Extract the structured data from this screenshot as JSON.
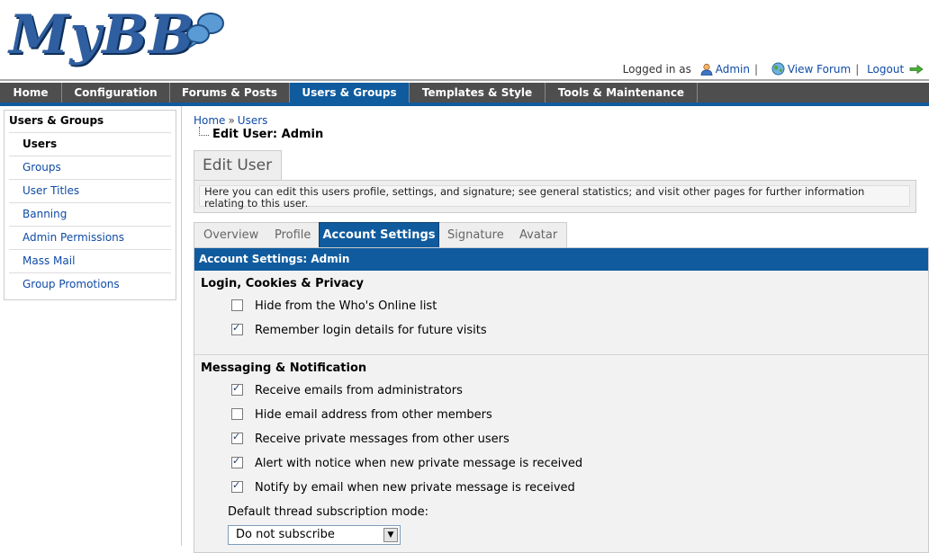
{
  "header": {
    "logo_text": "MyBB",
    "logged_in_as": "Logged in as",
    "user_name": "Admin",
    "view_forum": "View Forum",
    "logout": "Logout",
    "sep": "|"
  },
  "nav": {
    "tabs": [
      {
        "label": "Home"
      },
      {
        "label": "Configuration"
      },
      {
        "label": "Forums & Posts"
      },
      {
        "label": "Users & Groups"
      },
      {
        "label": "Templates & Style"
      },
      {
        "label": "Tools & Maintenance"
      }
    ]
  },
  "sidebar": {
    "title": "Users & Groups",
    "items": [
      {
        "label": "Users"
      },
      {
        "label": "Groups"
      },
      {
        "label": "User Titles"
      },
      {
        "label": "Banning"
      },
      {
        "label": "Admin Permissions"
      },
      {
        "label": "Mass Mail"
      },
      {
        "label": "Group Promotions"
      }
    ]
  },
  "breadcrumb": {
    "home": "Home",
    "sep": "»",
    "users": "Users",
    "current": "Edit User: Admin"
  },
  "page": {
    "title": "Edit User",
    "description": "Here you can edit this users profile, settings, and signature; see general statistics; and visit other pages for further information relating to this user."
  },
  "subtabs": [
    {
      "label": "Overview"
    },
    {
      "label": "Profile"
    },
    {
      "label": "Account Settings"
    },
    {
      "label": "Signature"
    },
    {
      "label": "Avatar"
    }
  ],
  "panel": {
    "header": "Account Settings: Admin",
    "section1": {
      "title": "Login, Cookies & Privacy",
      "options": [
        {
          "label": "Hide from the Who's Online list",
          "checked": false
        },
        {
          "label": "Remember login details for future visits",
          "checked": true
        }
      ]
    },
    "section2": {
      "title": "Messaging & Notification",
      "options": [
        {
          "label": "Receive emails from administrators",
          "checked": true
        },
        {
          "label": "Hide email address from other members",
          "checked": false
        },
        {
          "label": "Receive private messages from other users",
          "checked": true
        },
        {
          "label": "Alert with notice when new private message is received",
          "checked": true
        },
        {
          "label": "Notify by email when new private message is received",
          "checked": true
        }
      ],
      "subscription_label": "Default thread subscription mode:",
      "subscription_value": "Do not subscribe"
    }
  }
}
